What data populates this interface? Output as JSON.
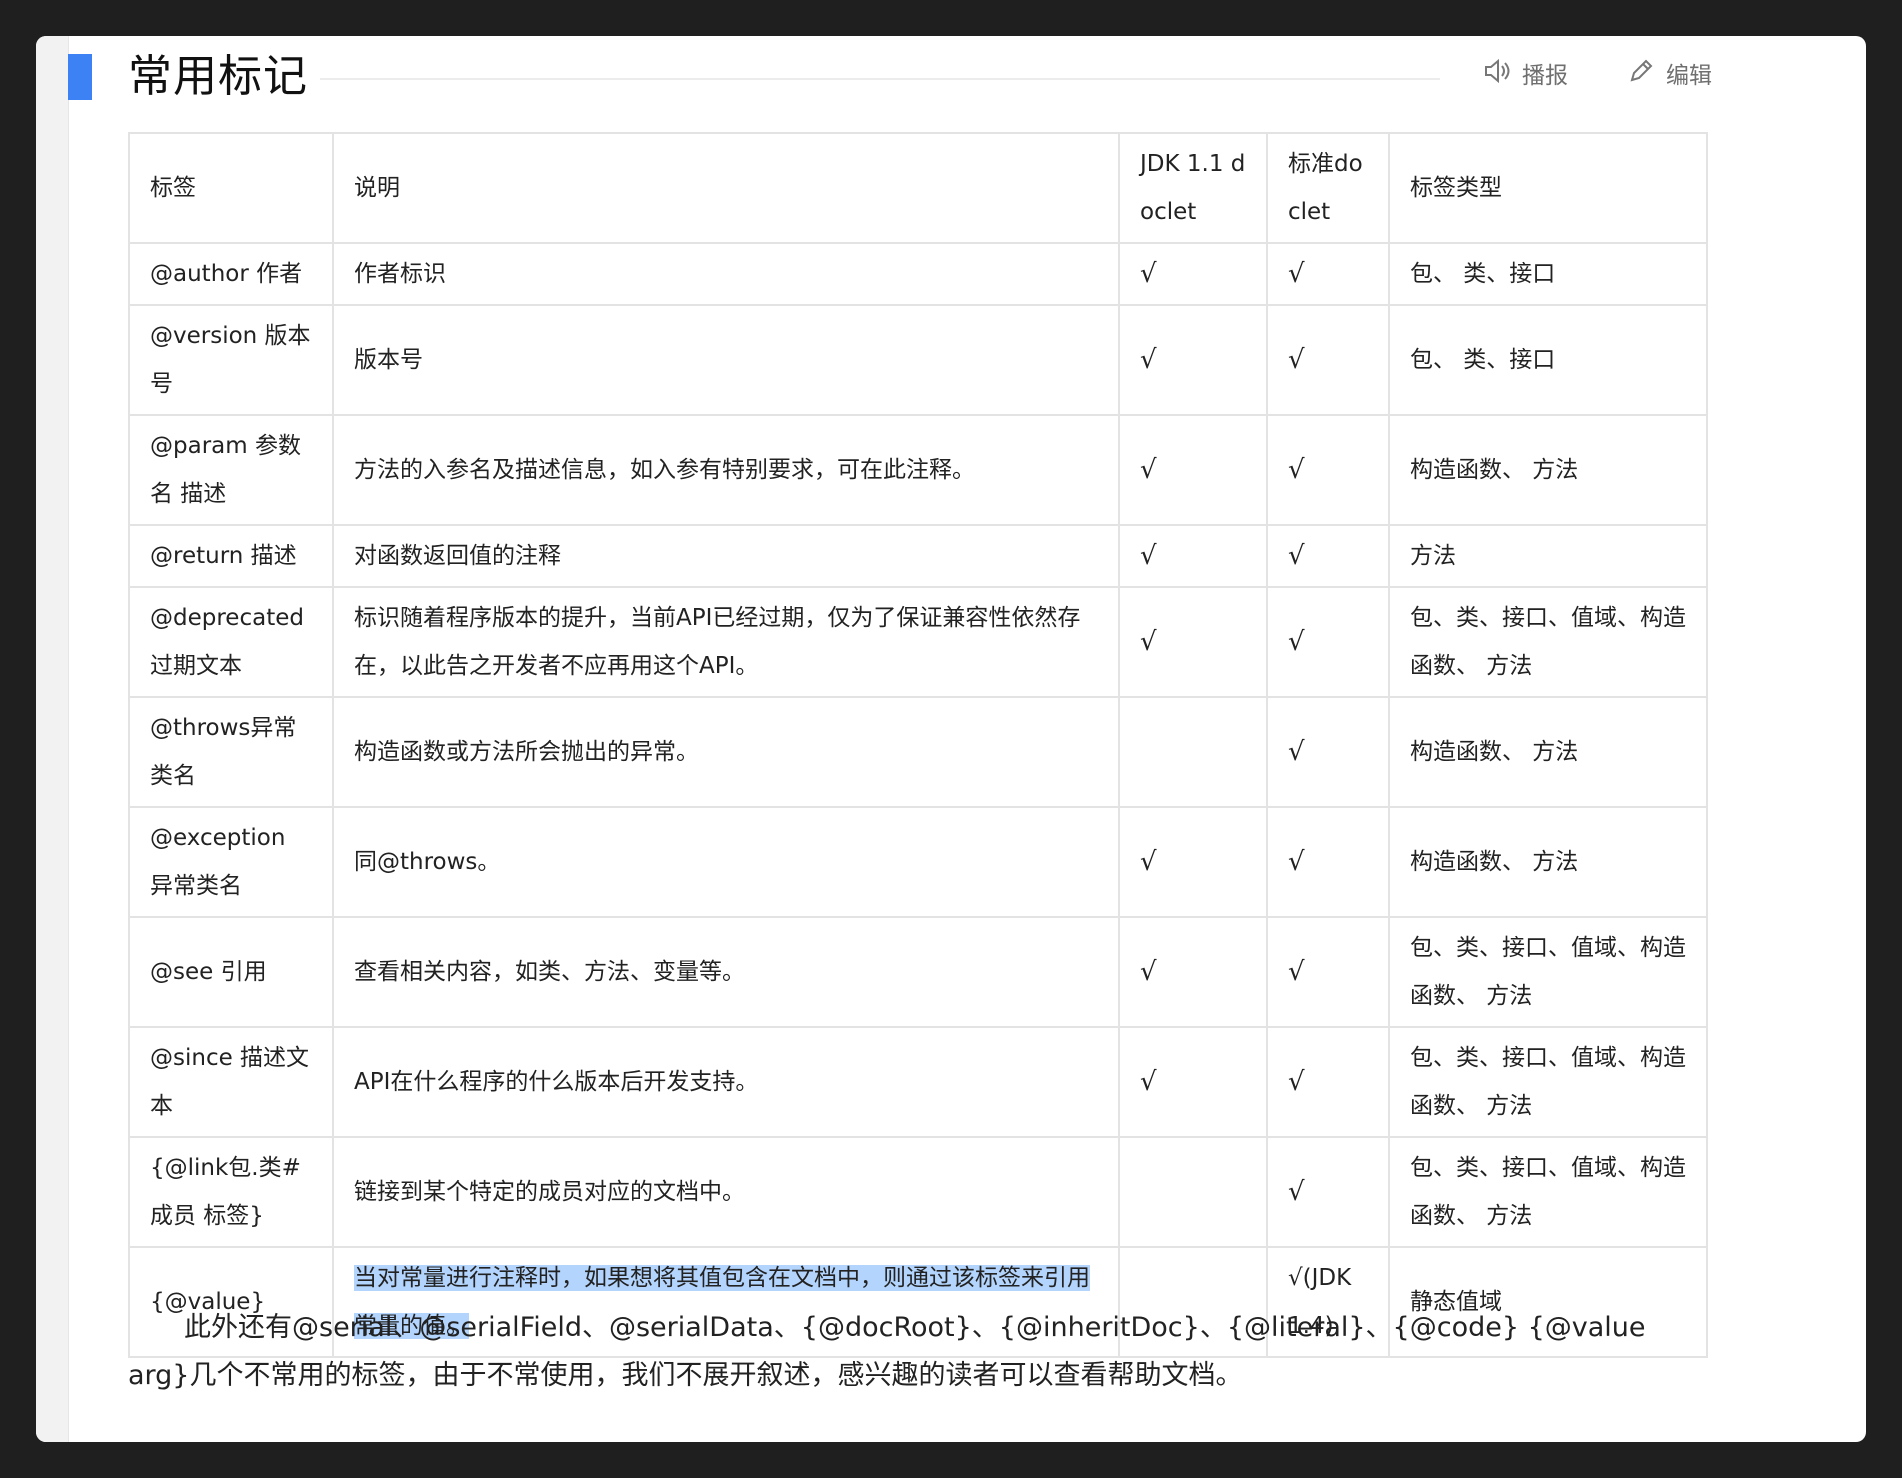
{
  "section": {
    "title": "常用标记",
    "speak_label": "播报",
    "edit_label": "编辑"
  },
  "table": {
    "headers": [
      "标签",
      "说明",
      "JDK 1.1 doclet",
      "标准doclet",
      "标签类型"
    ],
    "rows": [
      {
        "tag": "@author 作者",
        "desc": "作者标识",
        "jdk11": "√",
        "std": "√",
        "type": "包、 类、接口"
      },
      {
        "tag": "@version 版本号",
        "desc": "版本号",
        "jdk11": "√",
        "std": "√",
        "type": "包、 类、接口"
      },
      {
        "tag": "@param 参数名 描述",
        "desc": "方法的入参名及描述信息，如入参有特别要求，可在此注释。",
        "jdk11": "√",
        "std": "√",
        "type": "构造函数、 方法"
      },
      {
        "tag": "@return 描述",
        "desc": "对函数返回值的注释",
        "jdk11": "√",
        "std": "√",
        "type": "方法"
      },
      {
        "tag": "@deprecated 过期文本",
        "desc": "标识随着程序版本的提升，当前API已经过期，仅为了保证兼容性依然存在，以此告之开发者不应再用这个API。",
        "jdk11": "√",
        "std": "√",
        "type": "包、类、接口、值域、构造函数、 方法"
      },
      {
        "tag": "@throws异常类名",
        "desc": "构造函数或方法所会抛出的异常。",
        "jdk11": "",
        "std": "√",
        "type": "构造函数、 方法"
      },
      {
        "tag": "@exception 异常类名",
        "desc": "同@throws。",
        "jdk11": "√",
        "std": "√",
        "type": "构造函数、 方法"
      },
      {
        "tag": "@see 引用",
        "desc": "查看相关内容，如类、方法、变量等。",
        "jdk11": "√",
        "std": "√",
        "type": "包、类、接口、值域、构造函数、 方法"
      },
      {
        "tag": "@since 描述文本",
        "desc": "API在什么程序的什么版本后开发支持。",
        "jdk11": "√",
        "std": "√",
        "type": "包、类、接口、值域、构造函数、 方法"
      },
      {
        "tag": "{@link包.类#成员 标签}",
        "desc": "链接到某个特定的成员对应的文档中。",
        "jdk11": "",
        "std": "√",
        "type": "包、类、接口、值域、构造函数、 方法"
      },
      {
        "tag": "{@value}",
        "desc": "当对常量进行注释时，如果想将其值包含在文档中，则通过该标签来引用常量的值。",
        "jdk11": "",
        "std": "√(JDK 1.4)",
        "type": "静态值域"
      }
    ]
  },
  "paragraph": "此外还有@serial、@serialField、@serialData、{@docRoot}、{@inheritDoc}、{@literal}、{@code} {@value arg}几个不常用的标签，由于不常使用，我们不展开叙述，感兴趣的读者可以查看帮助文档。",
  "colors": {
    "accent": "#3d82f5",
    "selection": "#b3d4fc",
    "border": "#e3e3e3"
  }
}
